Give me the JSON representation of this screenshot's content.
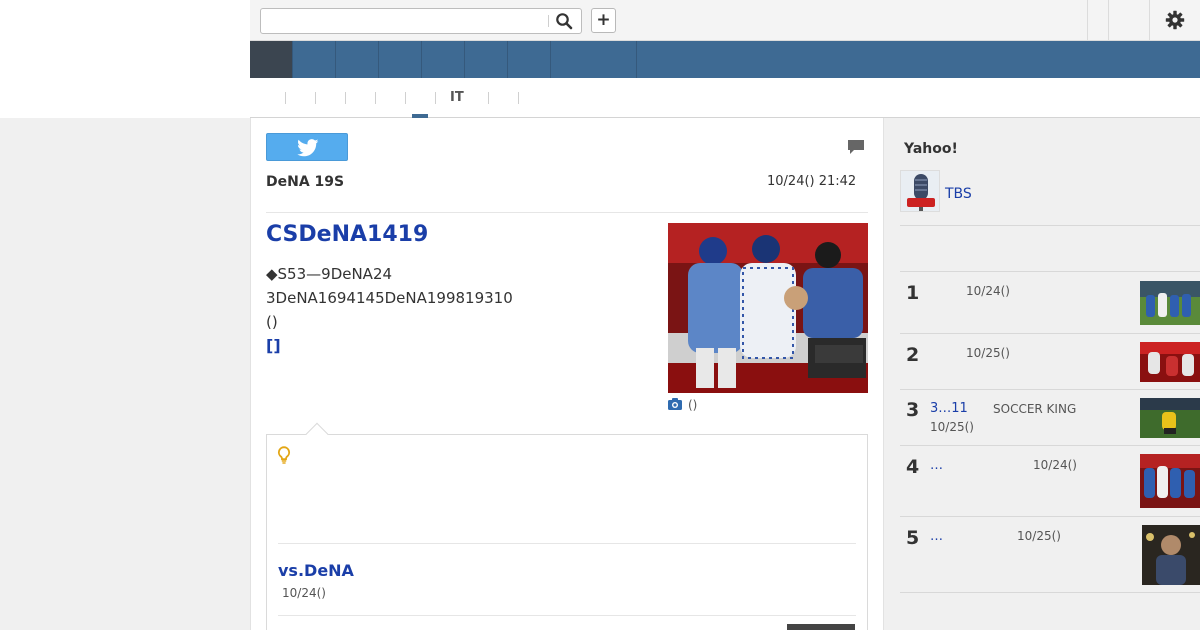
{
  "search": {
    "placeholder": "",
    "value": ""
  },
  "toolbar": {
    "add_label": "+"
  },
  "nav": {
    "cells": [
      "",
      "",
      "",
      "",
      "",
      "",
      "",
      ""
    ]
  },
  "subnav": {
    "items": [
      "",
      "",
      "",
      "",
      "",
      "IT",
      ""
    ]
  },
  "article": {
    "source": "DeNA 19S",
    "date": "10/24() 21:42",
    "headline": "CSDeNA1419",
    "summary_lines": [
      "◆S53—9DeNA24",
      "3DeNA1694145DeNA199819310",
      "()"
    ],
    "more_link": "[]",
    "photo_caption": "()"
  },
  "tip": {
    "related_title": "vs.DeNA",
    "related_date": "10/24()"
  },
  "sidebar": {
    "heading": "Yahoo!",
    "channel_name": "TBS",
    "ranking": [
      {
        "rank": "1",
        "title": "",
        "source": "",
        "date": "10/24()"
      },
      {
        "rank": "2",
        "title": "",
        "source": "",
        "date": "10/25()"
      },
      {
        "rank": "3",
        "title": "3…11",
        "source": "SOCCER KING",
        "date": "10/25()"
      },
      {
        "rank": "4",
        "title": "…",
        "source": "",
        "date": "10/24()"
      },
      {
        "rank": "5",
        "title": "…",
        "source": "",
        "date": "10/25()"
      }
    ]
  },
  "colors": {
    "nav_blue": "#3e6a93",
    "nav_active": "#3b4550",
    "link_blue": "#1a3ea8",
    "twitter": "#55acee"
  },
  "icons": [
    "search-icon",
    "plus-icon",
    "gear-icon",
    "twitter-icon",
    "comment-icon",
    "camera-icon",
    "lightbulb-icon"
  ]
}
